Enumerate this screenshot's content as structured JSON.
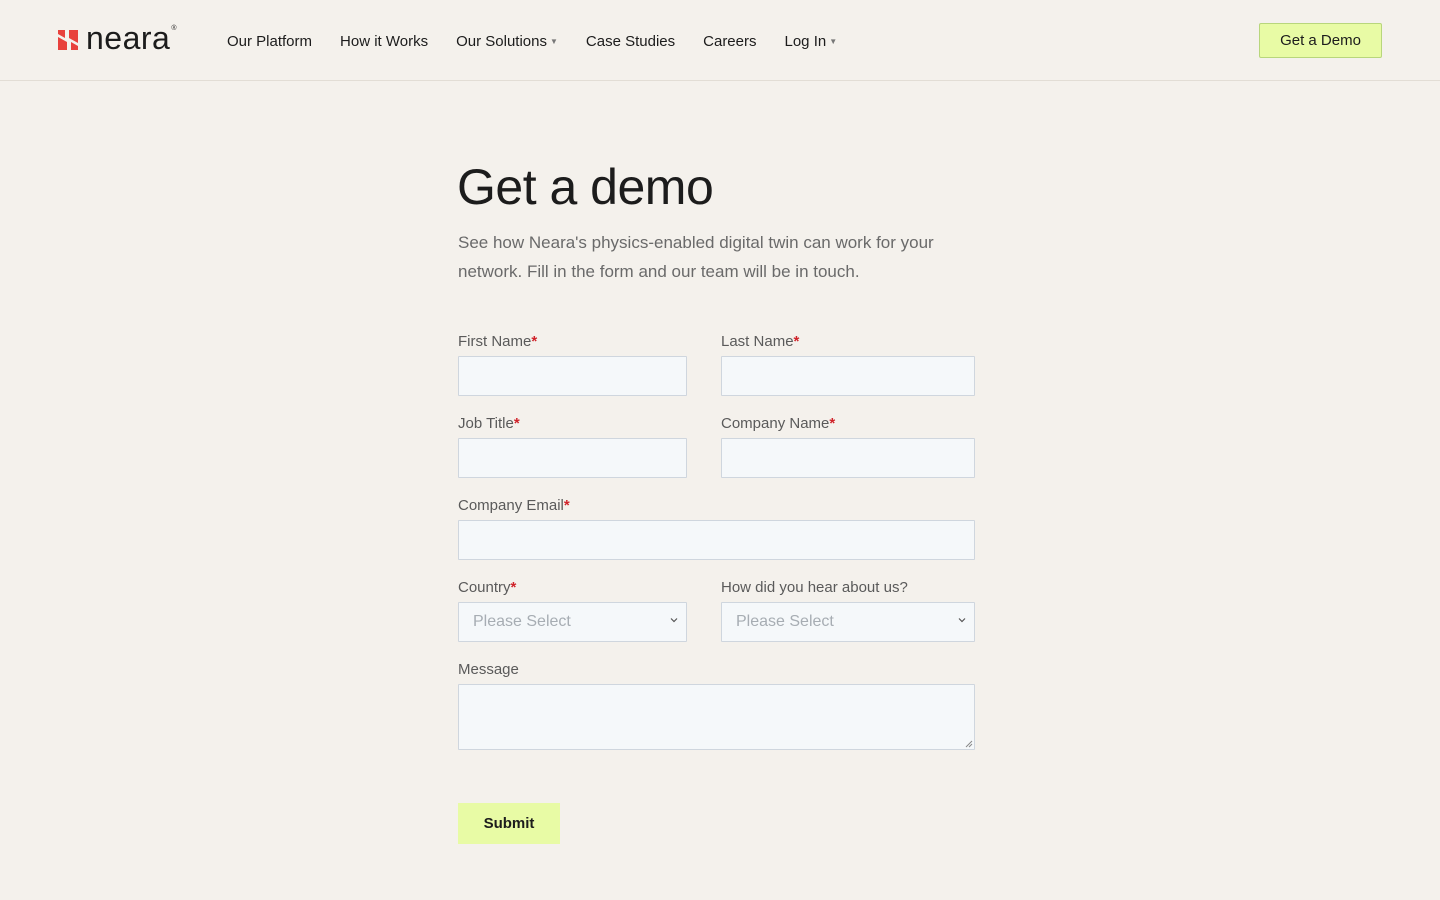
{
  "brand": {
    "name": "neara",
    "reg": "®",
    "accent": "#e8413c"
  },
  "nav": {
    "items": [
      {
        "label": "Our Platform",
        "caret": ""
      },
      {
        "label": "How it Works",
        "caret": ""
      },
      {
        "label": "Our Solutions",
        "caret": "▼"
      },
      {
        "label": "Case Studies",
        "caret": ""
      },
      {
        "label": "Careers",
        "caret": ""
      },
      {
        "label": "Log In",
        "caret": "▼"
      }
    ],
    "cta": "Get a Demo"
  },
  "page": {
    "title": "Get a demo",
    "intro": "See how Neara's physics-enabled digital twin can work for your network. Fill in the form and our team will be in touch."
  },
  "form": {
    "required_mark": "*",
    "first_name": {
      "label": "First Name",
      "value": ""
    },
    "last_name": {
      "label": "Last Name",
      "value": ""
    },
    "job_title": {
      "label": "Job Title",
      "value": ""
    },
    "company_name": {
      "label": "Company Name",
      "value": ""
    },
    "company_email": {
      "label": "Company Email",
      "value": ""
    },
    "country": {
      "label": "Country",
      "selected": "Please Select"
    },
    "hear_about": {
      "label": "How did you hear about us?",
      "selected": "Please Select"
    },
    "message": {
      "label": "Message",
      "value": ""
    },
    "submit": "Submit"
  },
  "colors": {
    "background": "#f4f1ec",
    "cta": "#e8fba5",
    "required": "#d0232a",
    "input_bg": "#f5f8fa"
  }
}
